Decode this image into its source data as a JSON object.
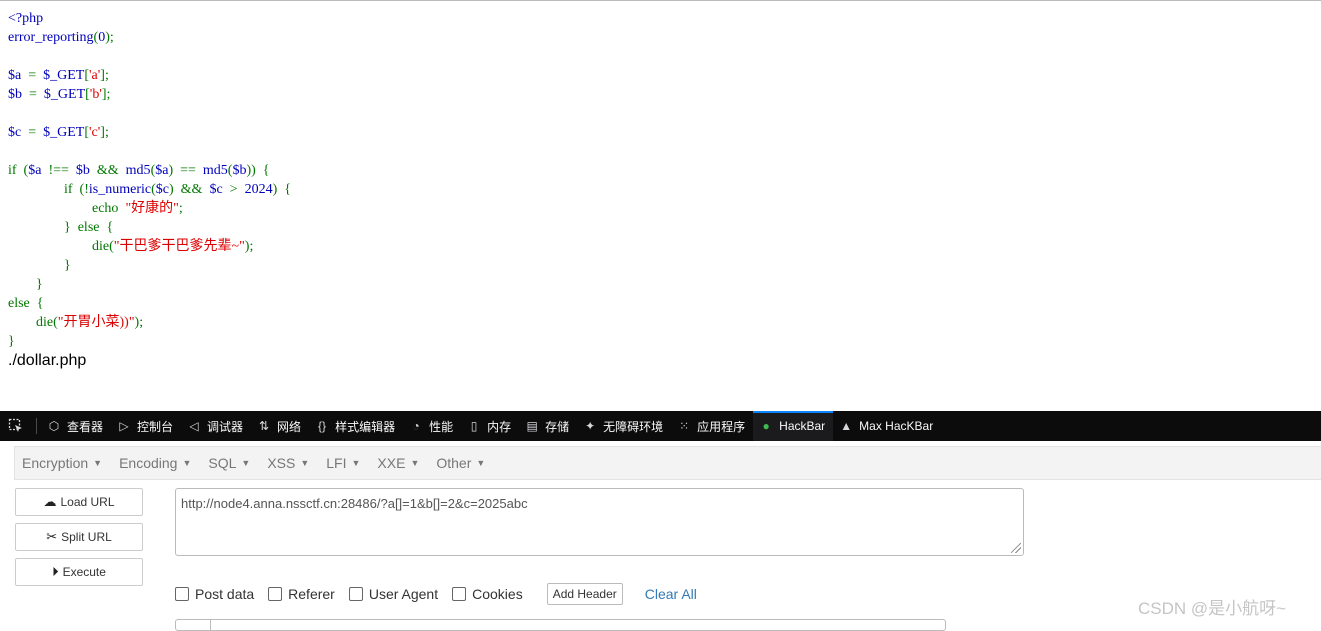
{
  "code_lines": [
    [
      {
        "t": "<?php",
        "c": "php"
      }
    ],
    [
      {
        "t": "error_reporting",
        "c": "php"
      },
      {
        "t": "(",
        "c": "kw"
      },
      {
        "t": "0",
        "c": "php"
      },
      {
        "t": ");",
        "c": "kw"
      }
    ],
    [],
    [
      {
        "t": "$a  ",
        "c": "php"
      },
      {
        "t": "=  ",
        "c": "kw"
      },
      {
        "t": "$_GET",
        "c": "php"
      },
      {
        "t": "[",
        "c": "kw"
      },
      {
        "t": "'a'",
        "c": "st"
      },
      {
        "t": "];",
        "c": "kw"
      }
    ],
    [
      {
        "t": "$b  ",
        "c": "php"
      },
      {
        "t": "=  ",
        "c": "kw"
      },
      {
        "t": "$_GET",
        "c": "php"
      },
      {
        "t": "[",
        "c": "kw"
      },
      {
        "t": "'b'",
        "c": "st"
      },
      {
        "t": "];",
        "c": "kw"
      }
    ],
    [],
    [
      {
        "t": "$c  ",
        "c": "php"
      },
      {
        "t": "=  ",
        "c": "kw"
      },
      {
        "t": "$_GET",
        "c": "php"
      },
      {
        "t": "[",
        "c": "kw"
      },
      {
        "t": "'c'",
        "c": "st"
      },
      {
        "t": "];",
        "c": "kw"
      }
    ],
    [],
    [
      {
        "t": "if  (",
        "c": "kw"
      },
      {
        "t": "$a  ",
        "c": "php"
      },
      {
        "t": "!==  ",
        "c": "kw"
      },
      {
        "t": "$b  ",
        "c": "php"
      },
      {
        "t": "&&  ",
        "c": "kw"
      },
      {
        "t": "md5",
        "c": "php"
      },
      {
        "t": "(",
        "c": "kw"
      },
      {
        "t": "$a",
        "c": "php"
      },
      {
        "t": ")  ==  ",
        "c": "kw"
      },
      {
        "t": "md5",
        "c": "php"
      },
      {
        "t": "(",
        "c": "kw"
      },
      {
        "t": "$b",
        "c": "php"
      },
      {
        "t": "))  {",
        "c": "kw"
      }
    ],
    [
      {
        "t": "                if  (!",
        "c": "kw"
      },
      {
        "t": "is_numeric",
        "c": "php"
      },
      {
        "t": "(",
        "c": "kw"
      },
      {
        "t": "$c",
        "c": "php"
      },
      {
        "t": ")  &&  ",
        "c": "kw"
      },
      {
        "t": "$c  ",
        "c": "php"
      },
      {
        "t": ">  ",
        "c": "kw"
      },
      {
        "t": "2024",
        "c": "php"
      },
      {
        "t": ")  {",
        "c": "kw"
      }
    ],
    [
      {
        "t": "                        echo  ",
        "c": "kw"
      },
      {
        "t": "\"好康的\"",
        "c": "st"
      },
      {
        "t": ";",
        "c": "kw"
      }
    ],
    [
      {
        "t": "                }  else  {",
        "c": "kw"
      }
    ],
    [
      {
        "t": "                        die",
        "c": "kw"
      },
      {
        "t": "(",
        "c": "kw"
      },
      {
        "t": "\"干巴爹干巴爹先辈~\"",
        "c": "st"
      },
      {
        "t": ");",
        "c": "kw"
      }
    ],
    [
      {
        "t": "                }",
        "c": "kw"
      }
    ],
    [
      {
        "t": "        }",
        "c": "kw"
      }
    ],
    [
      {
        "t": "else  {",
        "c": "kw"
      }
    ],
    [
      {
        "t": "        die",
        "c": "kw"
      },
      {
        "t": "(",
        "c": "kw"
      },
      {
        "t": "\"开胃小菜))\"",
        "c": "st"
      },
      {
        "t": ");",
        "c": "kw"
      }
    ],
    [
      {
        "t": "}",
        "c": "kw"
      }
    ]
  ],
  "path_text": "./dollar.php",
  "devtools": {
    "tools": [
      {
        "name": "inspector",
        "icon": "inspector-icon",
        "glyph": "⬡",
        "label": "查看器"
      },
      {
        "name": "console",
        "icon": "console-icon",
        "glyph": "▷",
        "label": "控制台"
      },
      {
        "name": "debugger",
        "icon": "debugger-icon",
        "glyph": "◁",
        "label": "调试器"
      },
      {
        "name": "network",
        "icon": "network-icon",
        "glyph": "⇅",
        "label": "网络"
      },
      {
        "name": "style-editor",
        "icon": "braces-icon",
        "glyph": "{}",
        "label": "样式编辑器"
      },
      {
        "name": "performance",
        "icon": "gauge-icon",
        "glyph": "◔",
        "label": "性能"
      },
      {
        "name": "memory",
        "icon": "memory-icon",
        "glyph": "▯",
        "label": "内存"
      },
      {
        "name": "storage",
        "icon": "storage-icon",
        "glyph": "▤",
        "label": "存储"
      },
      {
        "name": "accessibility",
        "icon": "accessibility-icon",
        "glyph": "✦",
        "label": "无障碍环境"
      },
      {
        "name": "application",
        "icon": "grid-icon",
        "glyph": "⁙",
        "label": "应用程序"
      },
      {
        "name": "hackbar",
        "icon": "hackbar-icon",
        "glyph": "●",
        "label": "HackBar",
        "active": true
      },
      {
        "name": "max-hackbar",
        "icon": "lock-icon",
        "glyph": "▲",
        "label": "Max HacKBar"
      }
    ]
  },
  "menu": [
    "Encryption",
    "Encoding",
    "SQL",
    "XSS",
    "LFI",
    "XXE",
    "Other"
  ],
  "buttons": {
    "load": "Load URL",
    "split": "Split URL",
    "execute": "Execute"
  },
  "url_value": "http://node4.anna.nssctf.cn:28486/?a[]=1&b[]=2&c=2025abc",
  "options": [
    "Post data",
    "Referer",
    "User Agent",
    "Cookies"
  ],
  "add_header": "Add Header",
  "clear_all": "Clear All",
  "watermark": "CSDN @是小航呀~"
}
